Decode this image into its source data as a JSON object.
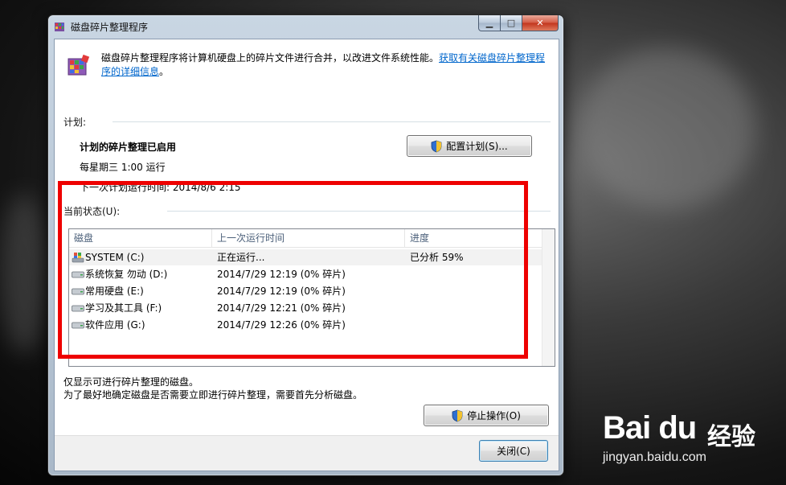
{
  "window": {
    "title": "磁盘碎片整理程序",
    "minimize_glyph": "▁",
    "maximize_glyph": "□",
    "close_glyph": "✕"
  },
  "intro": {
    "text": "磁盘碎片整理程序将计算机硬盘上的碎片文件进行合并，以改进文件系统性能。",
    "link": "获取有关磁盘碎片整理程序的详细信息",
    "tail": "。"
  },
  "schedule": {
    "label": "计划:",
    "status": "计划的碎片整理已启用",
    "run_time": "每星期三  1:00 运行",
    "next_run": "下一次计划运行时间: 2014/8/6 2:15",
    "configure_button": "配置计划(S)..."
  },
  "current_status": {
    "label": "当前状态(U):",
    "columns": [
      "磁盘",
      "上一次运行时间",
      "进度"
    ],
    "rows": [
      {
        "disk": "SYSTEM (C:)",
        "last_run": "正在运行...",
        "progress": "已分析 59%",
        "icon": "system-drive-icon"
      },
      {
        "disk": "系统恢复 勿动 (D:)",
        "last_run": "2014/7/29 12:19 (0% 碎片)",
        "progress": "",
        "icon": "drive-icon"
      },
      {
        "disk": "常用硬盘 (E:)",
        "last_run": "2014/7/29 12:19 (0% 碎片)",
        "progress": "",
        "icon": "drive-icon"
      },
      {
        "disk": " 学习及其工具 (F:)",
        "last_run": "2014/7/29 12:21 (0% 碎片)",
        "progress": "",
        "icon": "drive-icon"
      },
      {
        "disk": "软件应用 (G:)",
        "last_run": "2014/7/29 12:26 (0% 碎片)",
        "progress": "",
        "icon": "drive-icon"
      }
    ]
  },
  "notes": {
    "line1": "仅显示可进行碎片整理的磁盘。",
    "line2": "为了最好地确定磁盘是否需要立即进行碎片整理，需要首先分析磁盘。"
  },
  "buttons": {
    "stop": "停止操作(O)",
    "close": "关闭(C)"
  },
  "watermark": {
    "logo": "Bai du",
    "brand_cn": "经验",
    "url": "jingyan.baidu.com"
  },
  "colors": {
    "highlight": "#ee0000",
    "link": "#0066cc",
    "header_text": "#4c607a"
  }
}
